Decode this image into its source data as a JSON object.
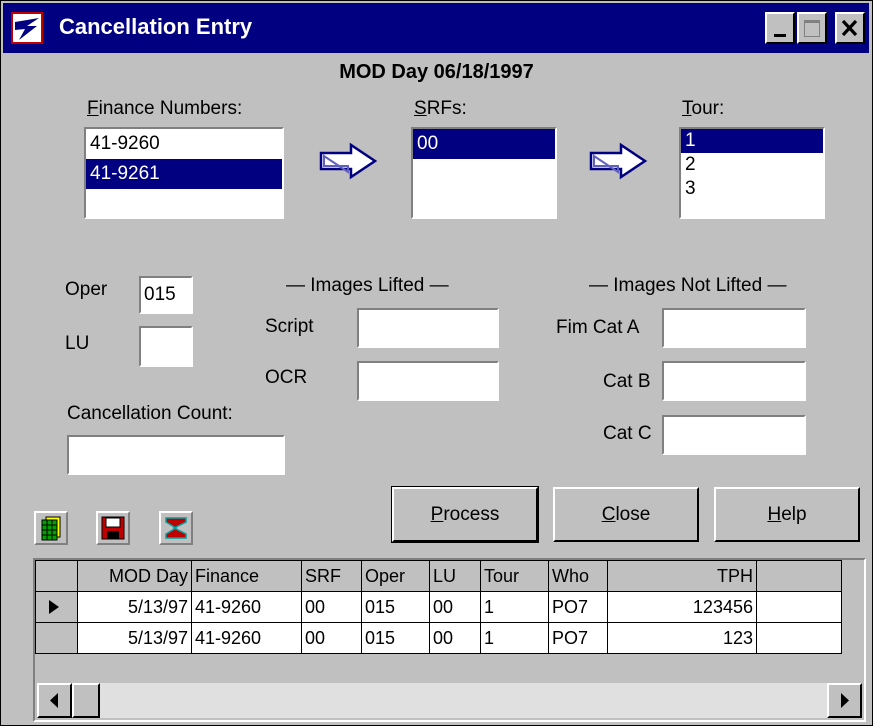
{
  "window": {
    "title": "Cancellation Entry"
  },
  "header": {
    "mod_day": "MOD Day 06/18/1997"
  },
  "finance": {
    "label_access": "F",
    "label_rest": "inance Numbers:",
    "items": [
      "41-9260",
      "41-9261"
    ]
  },
  "srfs": {
    "label_access": "S",
    "label_rest": "RFs:",
    "items": [
      "00"
    ]
  },
  "tour": {
    "label_access": "T",
    "label_rest": "our:",
    "items": [
      "1",
      "2",
      "3"
    ]
  },
  "fields": {
    "oper_label": "Oper",
    "oper_value": "015",
    "lu_label": "LU",
    "lu_value": "",
    "cancellation_count_label": "Cancellation Count:",
    "cancellation_count_value": ""
  },
  "images_lifted": {
    "heading": "— Images Lifted —",
    "script_label": "Script",
    "ocr_label": "OCR"
  },
  "images_not_lifted": {
    "heading": "— Images Not Lifted —",
    "fim_cat_a_label": "Fim Cat A",
    "cat_b_label": "Cat B",
    "cat_c_label": "Cat C"
  },
  "buttons": {
    "process_access": "P",
    "process_rest": "rocess",
    "close_access": "C",
    "close_rest": "lose",
    "help_access": "H",
    "help_rest": "elp"
  },
  "toolbar": {
    "icons": [
      "spreadsheet-icon",
      "save-icon",
      "sum-icon"
    ]
  },
  "grid": {
    "columns": [
      "MOD Day",
      "Finance",
      "SRF",
      "Oper",
      "LU",
      "Tour",
      "Who",
      "TPH",
      ""
    ],
    "rows": [
      [
        "5/13/97",
        "41-9260",
        "00",
        "015",
        "00",
        "1",
        "PO7",
        "123456",
        ""
      ],
      [
        "5/13/97",
        "41-9260",
        "00",
        "015",
        "00",
        "1",
        "PO7",
        "123",
        ""
      ]
    ]
  }
}
